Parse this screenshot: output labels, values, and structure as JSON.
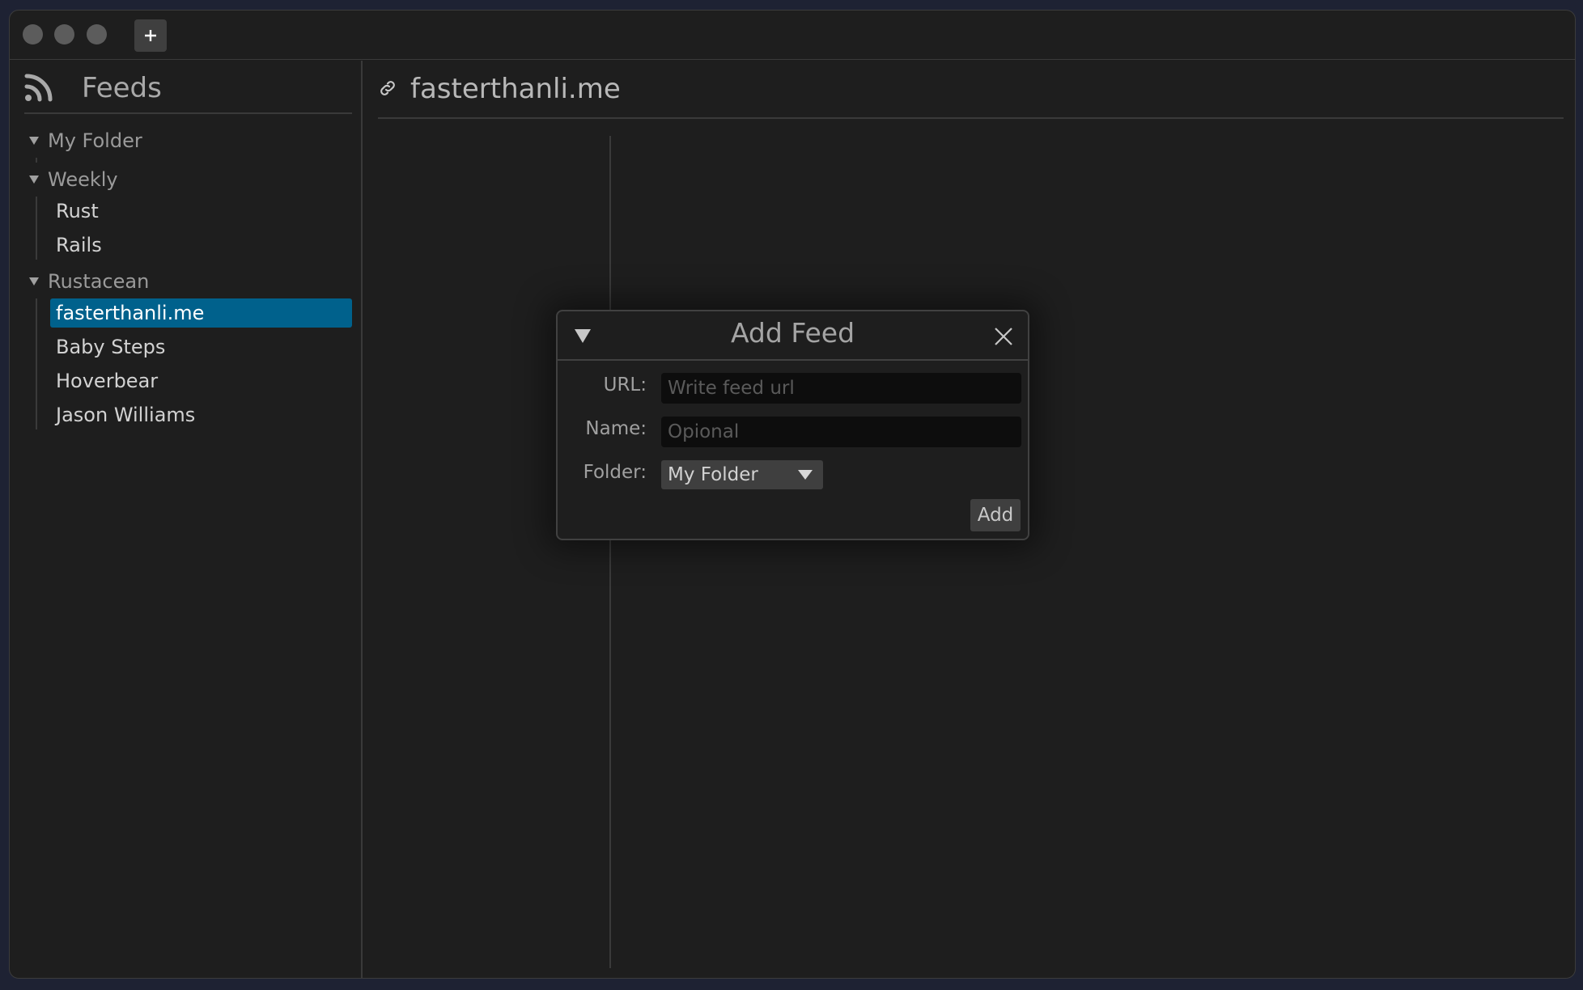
{
  "sidebar": {
    "title": "Feeds",
    "folders": [
      {
        "name": "My Folder",
        "items": []
      },
      {
        "name": "Weekly",
        "items": [
          "Rust",
          "Rails"
        ]
      },
      {
        "name": "Rustacean",
        "items": [
          "fasterthanli.me",
          "Baby Steps",
          "Hoverbear",
          "Jason Williams"
        ]
      }
    ],
    "selected_item": "fasterthanli.me"
  },
  "content": {
    "title": "fasterthanli.me"
  },
  "dialog": {
    "title": "Add Feed",
    "url_label": "URL:",
    "url_placeholder": "Write feed url",
    "name_label": "Name:",
    "name_placeholder": "Opional",
    "folder_label": "Folder:",
    "folder_value": "My Folder",
    "add_label": "Add"
  },
  "colors": {
    "selection": "#00618c",
    "background": "#1e1e1e"
  }
}
